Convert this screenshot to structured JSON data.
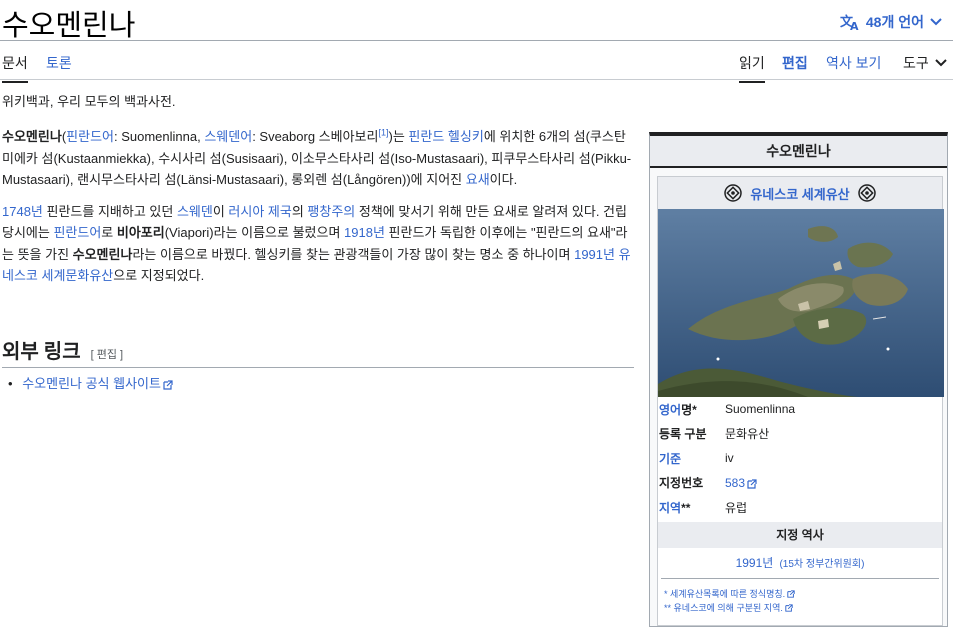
{
  "page": {
    "title": "수오멘린나",
    "languages": "48개 언어",
    "tabs_left": [
      "문서",
      "토론"
    ],
    "tabs_right": [
      "읽기",
      "편집",
      "역사 보기",
      "도구"
    ],
    "tagline": "위키백과, 우리 모두의 백과사전."
  },
  "article": {
    "p1": {
      "name": "수오멘린나",
      "lang1": "핀란드어",
      "name_fi": ": Suomenlinna, ",
      "lang2": "스웨덴어",
      "name_sv": ": Sveaborg 스베아보리",
      "ref": "[1]",
      "t1": ")는 ",
      "link1": "핀란드",
      "link2": "헬싱키",
      "t2": "에 위치한 6개의 섬(쿠스탄미에카 섬(Kustaanmiekka), 수시사리 섬(Susisaari), 이소무스타사리 섬(Iso-Mustasaari), 피쿠무스타사리 섬(Pikku-Mustasaari), 랜시무스타사리 섬(Länsi-Mustasaari), 롱외렌 섬(Långören))에 지어진 ",
      "link3": "요새",
      "t3": "이다."
    },
    "p2": {
      "year1": "1748년",
      "t1": " 핀란드를 지배하고 있던 ",
      "link1": "스웨덴",
      "t2": "이 ",
      "link2": "러시아 제국",
      "t3": "의 ",
      "link3": "팽창주의",
      "t4": " 정책에 맞서기 위해 만든 요새로 알려져 있다. 건립 당시에는 ",
      "link4": "핀란드어",
      "t5": "로 ",
      "bold1": "비아포리",
      "t6": "(Viapori)라는 이름으로 불렀으며 ",
      "year2": "1918년",
      "t7": " 핀란드가 독립한 이후에는 \"핀란드의 요새\"라는 뜻을 가진 ",
      "bold2": "수오멘린나",
      "t8": "라는 이름으로 바꿨다. 헬싱키를 찾는 관광객들이 가장 많이 찾는 명소 중 하나이며 ",
      "link5": "1991년",
      "t9": " ",
      "link6": "유네스코 세계문화유산",
      "t10": "으로 지정되었다."
    },
    "section_title": "외부 링크",
    "section_edit": "[ 편집 ]",
    "external_link": "수오멘린나 공식 웹사이트"
  },
  "infobox": {
    "caption": "수오멘린나",
    "heritage": "유네스코 세계유산",
    "rows": [
      {
        "key_link": "영어",
        "key_rest": "명*",
        "value": "Suomenlinna"
      },
      {
        "key_link": "",
        "key_rest": "등록 구분",
        "value": "문화유산"
      },
      {
        "key_link": "기준",
        "key_rest": "",
        "value": "iv"
      },
      {
        "key_link": "",
        "key_rest": "지정번호",
        "value": "583"
      },
      {
        "key_link": "지역",
        "key_rest": "**",
        "value": "유럽"
      }
    ],
    "history_title": "지정 역사",
    "year": "1991년",
    "session": "(15차 정부간위원회)",
    "note1": "* 세계유산목록에 따른 정식명칭.",
    "note2": "** 유네스코에 의해 구분된 지역."
  },
  "colors": {
    "link": "#3366cc",
    "text": "#202122",
    "border": "#a2a9b1",
    "infobox_bg": "#f8f9fa",
    "header_bg": "#eaecf0"
  },
  "icons": [
    "translate-icon",
    "chevron-down-icon",
    "external-link-icon",
    "unesco-emblem-icon"
  ]
}
